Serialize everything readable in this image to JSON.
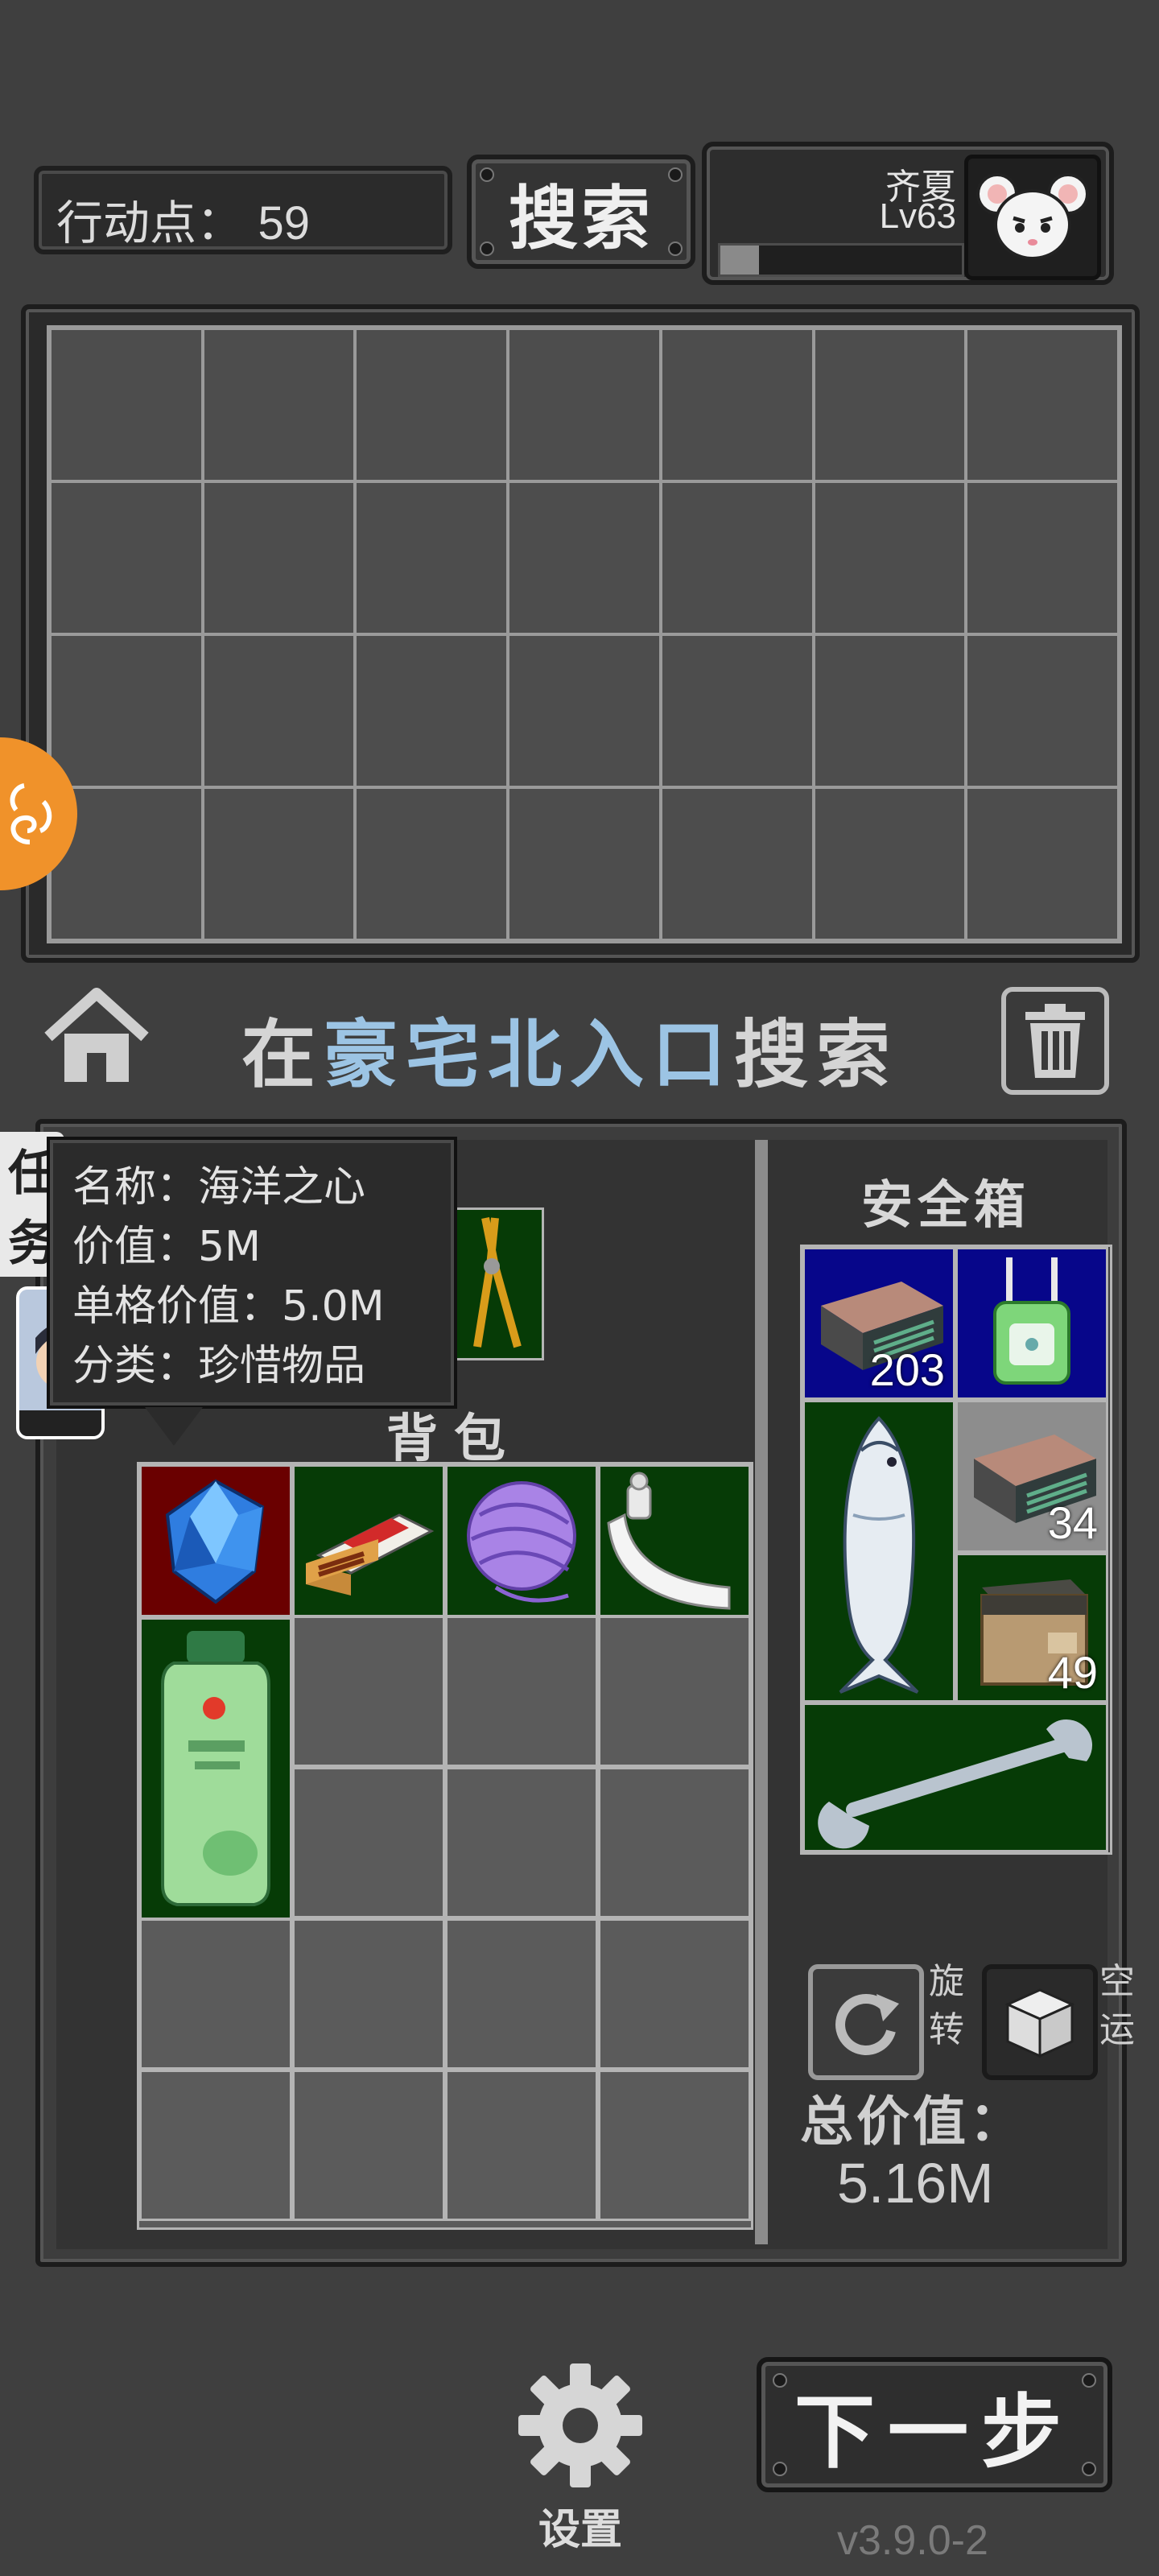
{
  "top_bar": {
    "action_points_label": "行动点：",
    "action_points_value": "59",
    "search_button": "搜索",
    "player": {
      "name": "齐夏",
      "level": "Lv63",
      "xp_fraction": 0.16
    }
  },
  "location": {
    "prefix": "在",
    "place": "豪宅北入口",
    "suffix": "搜索"
  },
  "quest_tab": {
    "label_line1": "任",
    "label_line2": "务"
  },
  "tooltip": {
    "name_label": "名称：",
    "name": "海洋之心",
    "value_label": "价值：",
    "value": "5M",
    "unit_value_label": "单格价值：",
    "unit_value": "5.0M",
    "category_label": "分类：",
    "category": "珍惜物品"
  },
  "backpack": {
    "title": "背包",
    "items": [
      {
        "icon": "blue-gem-icon",
        "rarity": "red"
      },
      {
        "icon": "matchbox-icon",
        "rarity": "green"
      },
      {
        "icon": "yarn-ball-icon",
        "rarity": "green"
      },
      {
        "icon": "toothpaste-tube-icon",
        "rarity": "green"
      },
      {
        "icon": "shampoo-bottle-icon",
        "rarity": "green"
      }
    ]
  },
  "safe_box": {
    "title": "安全箱",
    "items": [
      {
        "icon": "rubber-eraser-icon",
        "count": "203",
        "rarity": "blue"
      },
      {
        "icon": "wifi-router-icon",
        "rarity": "blue"
      },
      {
        "icon": "fish-icon",
        "rarity": "green"
      },
      {
        "icon": "rubber-eraser-icon",
        "count": "34",
        "rarity": "gray"
      },
      {
        "icon": "supply-box-icon",
        "count": "49",
        "rarity": "green"
      },
      {
        "icon": "wrench-icon",
        "rarity": "green"
      }
    ],
    "rotate_label": "旋转",
    "airdrop_label": "空运",
    "total_label": "总价值：",
    "total_value": "5.16M"
  },
  "bottom": {
    "settings_label": "设置",
    "next_button": "下一步",
    "version": "v3.9.0-2"
  },
  "colors": {
    "background": "#3f3f3f",
    "location_highlight": "#9cc4e4",
    "side_tab": "#f0922a",
    "rarity_green": "#063b06",
    "rarity_red": "#6a0000",
    "rarity_blue": "#07068a"
  }
}
